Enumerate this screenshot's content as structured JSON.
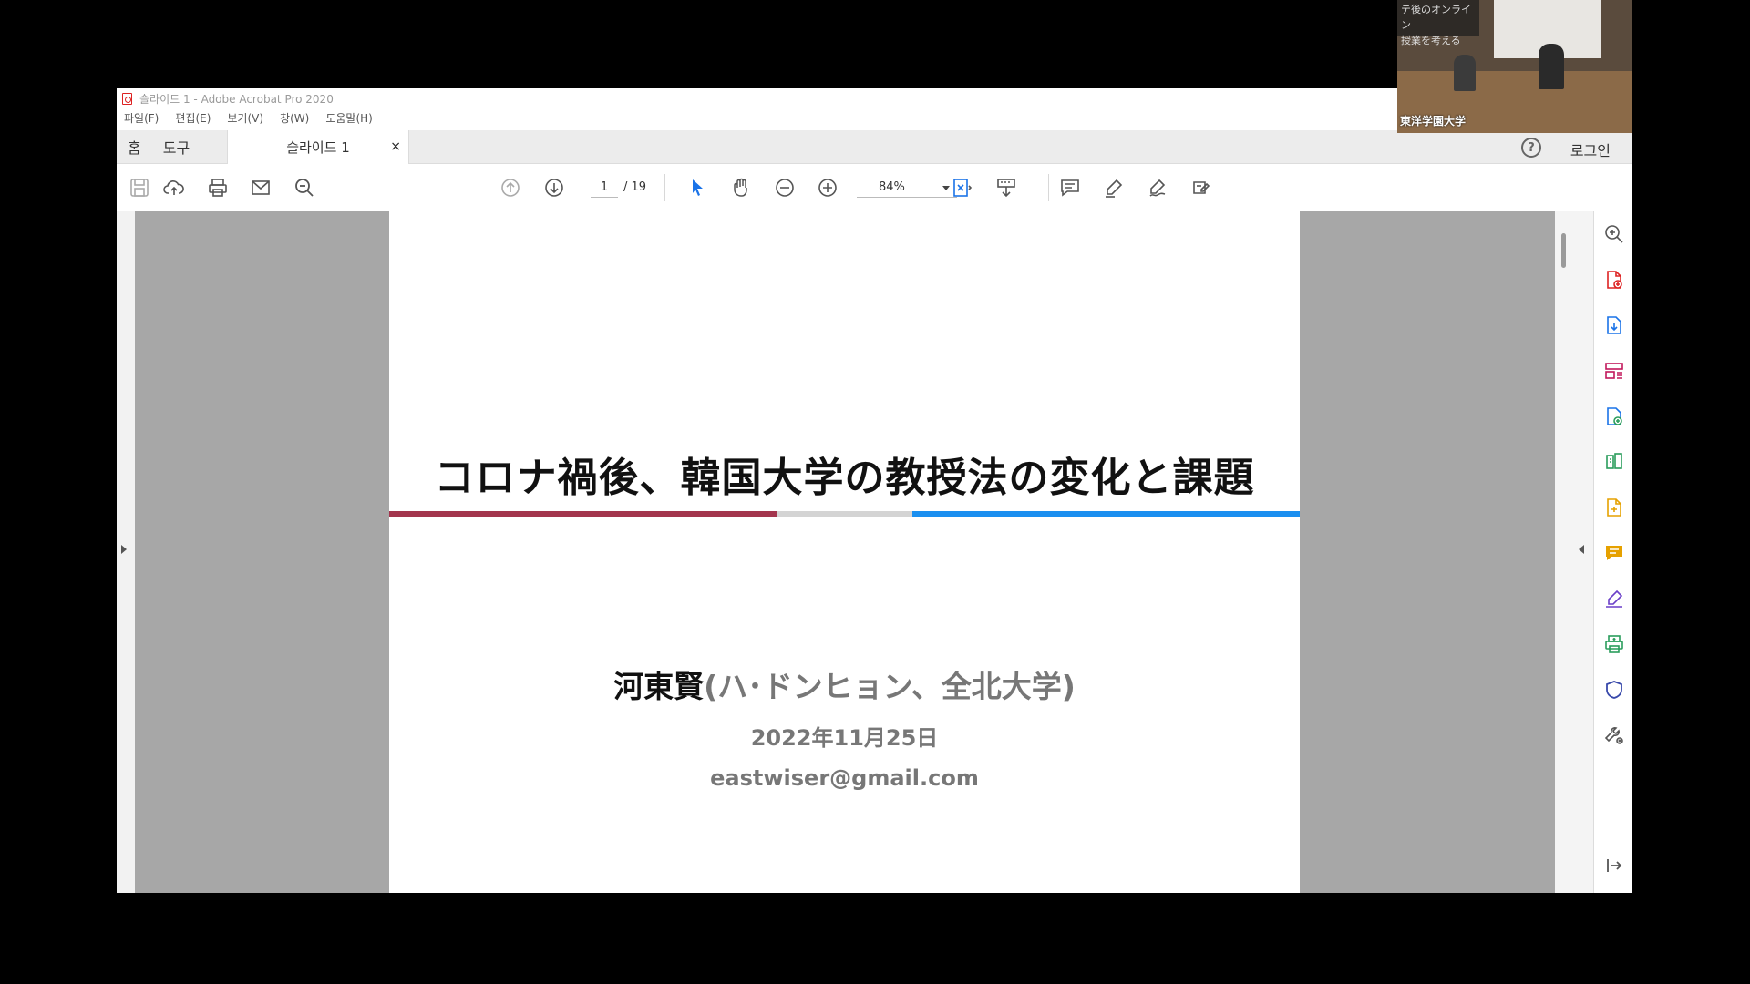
{
  "window": {
    "title": "슬라이드 1 - Adobe Acrobat Pro 2020"
  },
  "menu": [
    "파일(F)",
    "편집(E)",
    "보기(V)",
    "창(W)",
    "도움말(H)"
  ],
  "tabs": {
    "home": "홈",
    "tools": "도구",
    "document": "슬라이드 1",
    "close": "×",
    "help": "?",
    "login": "로그인"
  },
  "toolbar": {
    "page_current": "1",
    "page_total": "/ 19",
    "zoom": "84%"
  },
  "slide": {
    "title": "コロナ禍後、韓国大学の教授法の変化と課題",
    "author_name": "河東賢",
    "author_affiliation": "(ハ･ドンヒョン、全北大学)",
    "date": "2022年11月25日",
    "email": "eastwiser@gmail.com",
    "rule_colors": [
      "#a3354d",
      "#d4d4d4",
      "#1a8ff0"
    ]
  },
  "camera": {
    "sign_line1": "テ後のオンライン",
    "sign_line2": "授業を考える",
    "label": "東洋学園大学"
  },
  "colors": {
    "accent_red": "#d22222",
    "accent_blue": "#1a73e8"
  }
}
